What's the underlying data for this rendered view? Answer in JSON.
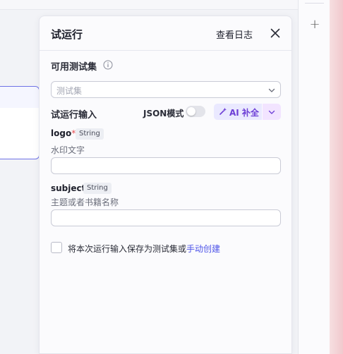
{
  "panel": {
    "title": "试运行",
    "view_log": "查看日志"
  },
  "test_set": {
    "label": "可用测试集",
    "placeholder": "测试集"
  },
  "run_input": {
    "label": "试运行输入",
    "json_mode_label": "JSON模式",
    "json_mode_on": false,
    "ai_fill_label": "AI 补全"
  },
  "fields": [
    {
      "name": "logo",
      "required_mark": "*",
      "type": "String",
      "description": "水印文字",
      "value": ""
    },
    {
      "name": "subject",
      "required_mark": "",
      "type": "String",
      "description": "主题或者书籍名称",
      "value": ""
    }
  ],
  "save_option": {
    "text": "将本次运行输入保存为测试集或",
    "link": "手动创建",
    "checked": false
  },
  "rail": {
    "add_symbol": "+"
  },
  "colors": {
    "accent": "#4d53e8",
    "ai_text": "#6d3fd6",
    "required": "#e5484d"
  }
}
